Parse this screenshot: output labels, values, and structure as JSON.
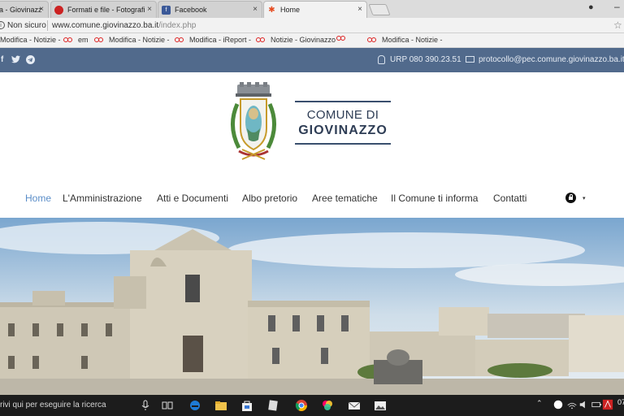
{
  "browser": {
    "tabs": [
      {
        "label": "a - Giovinazz",
        "icon": "red-circle-icon",
        "active": false
      },
      {
        "label": "Formati e file - Fotografi",
        "icon": "red-circle-icon",
        "active": false
      },
      {
        "label": "Facebook",
        "icon": "facebook-icon",
        "active": false
      },
      {
        "label": "Home",
        "icon": "joomla-icon",
        "active": true
      }
    ],
    "close_glyph": "×",
    "address": {
      "security_label": "Non sicuro",
      "url_host": "www.comune.giovinazzo.ba.it",
      "url_path": "/index.php"
    },
    "bookmarks": [
      "Modifica - Notizie -",
      "Modifica - Notizie -",
      "em",
      "Modifica - Notizie -",
      "Modifica - iReport -",
      "Notizie - Giovinazzo",
      "Modifica - Notizie -"
    ]
  },
  "site": {
    "topbar": {
      "social_icons": [
        "facebook-icon",
        "twitter-icon",
        "telegram-icon"
      ],
      "urp": "URP 080 390.23.51",
      "pec": "protocollo@pec.comune.giovinazzo.ba.it"
    },
    "logo": {
      "line1": "COMUNE DI",
      "line2": "GIOVINAZZO"
    },
    "nav": [
      {
        "label": "Home",
        "active": true
      },
      {
        "label": "L'Amministrazione",
        "active": false
      },
      {
        "label": "Atti e Documenti",
        "active": false
      },
      {
        "label": "Albo pretorio",
        "active": false
      },
      {
        "label": "Aree tematiche",
        "active": false
      },
      {
        "label": "Il Comune ti informa",
        "active": false
      },
      {
        "label": "Contatti",
        "active": false
      }
    ],
    "lock_caret": "▾"
  },
  "taskbar": {
    "search_placeholder": "rivi qui per eseguire la ricerca",
    "time": "07"
  },
  "colors": {
    "topbar_bg": "#516a8c",
    "nav_active": "#5a8dc8",
    "logo_text": "#2e3d55"
  }
}
